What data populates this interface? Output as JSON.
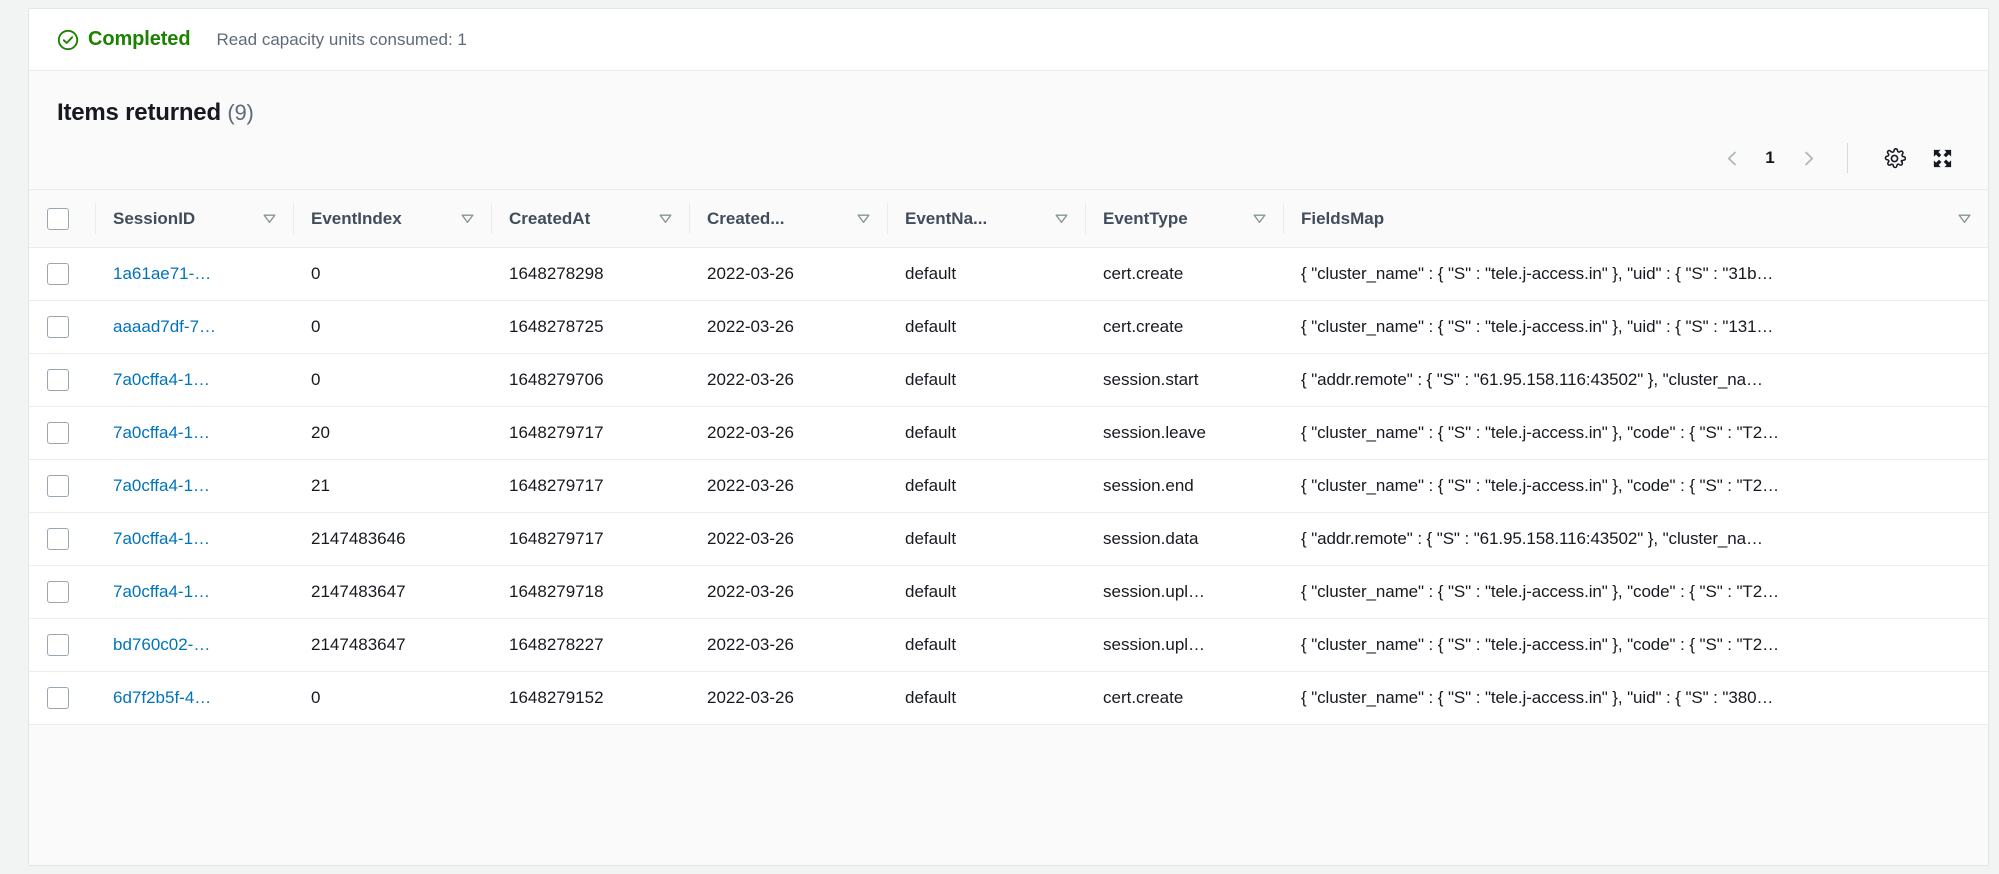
{
  "status": {
    "icon": "check-circle-icon",
    "label": "Completed",
    "meta": "Read capacity units consumed: 1",
    "color": "#1d8102"
  },
  "results": {
    "title": "Items returned",
    "count": "(9)"
  },
  "toolbar": {
    "prev_page_label": "‹",
    "page_number": "1",
    "next_page_label": "›",
    "settings_icon": "gear-icon",
    "fullscreen_icon": "expand-icon"
  },
  "table": {
    "columns": [
      {
        "key": "sessionid",
        "label": "SessionID",
        "sortable": true
      },
      {
        "key": "eventindex",
        "label": "EventIndex",
        "sortable": true
      },
      {
        "key": "createdat",
        "label": "CreatedAt",
        "sortable": true
      },
      {
        "key": "createddate",
        "label": "Created...",
        "sortable": true
      },
      {
        "key": "eventname",
        "label": "EventNa...",
        "sortable": true
      },
      {
        "key": "eventtype",
        "label": "EventType",
        "sortable": true
      },
      {
        "key": "fieldsmap",
        "label": "FieldsMap",
        "sortable": true
      }
    ],
    "rows": [
      {
        "sessionid": "1a61ae71-…",
        "eventindex": "0",
        "createdat": "1648278298",
        "createddate": "2022-03-26",
        "eventname": "default",
        "eventtype": "cert.create",
        "fieldsmap": "{ \"cluster_name\" : { \"S\" : \"tele.j-access.in\" }, \"uid\" : { \"S\" : \"31b…"
      },
      {
        "sessionid": "aaaad7df-7…",
        "eventindex": "0",
        "createdat": "1648278725",
        "createddate": "2022-03-26",
        "eventname": "default",
        "eventtype": "cert.create",
        "fieldsmap": "{ \"cluster_name\" : { \"S\" : \"tele.j-access.in\" }, \"uid\" : { \"S\" : \"131…"
      },
      {
        "sessionid": "7a0cffa4-1…",
        "eventindex": "0",
        "createdat": "1648279706",
        "createddate": "2022-03-26",
        "eventname": "default",
        "eventtype": "session.start",
        "fieldsmap": "{ \"addr.remote\" : { \"S\" : \"61.95.158.116:43502\" }, \"cluster_na…"
      },
      {
        "sessionid": "7a0cffa4-1…",
        "eventindex": "20",
        "createdat": "1648279717",
        "createddate": "2022-03-26",
        "eventname": "default",
        "eventtype": "session.leave",
        "fieldsmap": "{ \"cluster_name\" : { \"S\" : \"tele.j-access.in\" }, \"code\" : { \"S\" : \"T2…"
      },
      {
        "sessionid": "7a0cffa4-1…",
        "eventindex": "21",
        "createdat": "1648279717",
        "createddate": "2022-03-26",
        "eventname": "default",
        "eventtype": "session.end",
        "fieldsmap": "{ \"cluster_name\" : { \"S\" : \"tele.j-access.in\" }, \"code\" : { \"S\" : \"T2…"
      },
      {
        "sessionid": "7a0cffa4-1…",
        "eventindex": "2147483646",
        "createdat": "1648279717",
        "createddate": "2022-03-26",
        "eventname": "default",
        "eventtype": "session.data",
        "fieldsmap": "{ \"addr.remote\" : { \"S\" : \"61.95.158.116:43502\" }, \"cluster_na…"
      },
      {
        "sessionid": "7a0cffa4-1…",
        "eventindex": "2147483647",
        "createdat": "1648279718",
        "createddate": "2022-03-26",
        "eventname": "default",
        "eventtype": "session.upl…",
        "fieldsmap": "{ \"cluster_name\" : { \"S\" : \"tele.j-access.in\" }, \"code\" : { \"S\" : \"T2…"
      },
      {
        "sessionid": "bd760c02-…",
        "eventindex": "2147483647",
        "createdat": "1648278227",
        "createddate": "2022-03-26",
        "eventname": "default",
        "eventtype": "session.upl…",
        "fieldsmap": "{ \"cluster_name\" : { \"S\" : \"tele.j-access.in\" }, \"code\" : { \"S\" : \"T2…"
      },
      {
        "sessionid": "6d7f2b5f-4…",
        "eventindex": "0",
        "createdat": "1648279152",
        "createddate": "2022-03-26",
        "eventname": "default",
        "eventtype": "cert.create",
        "fieldsmap": "{ \"cluster_name\" : { \"S\" : \"tele.j-access.in\" }, \"uid\" : { \"S\" : \"380…"
      }
    ]
  },
  "colors": {
    "link": "#0073bb",
    "success": "#1d8102",
    "header_text": "#414d5c",
    "body_text": "#16191f",
    "muted": "#5f6b7a",
    "border": "#e9ebed",
    "section_bg": "#fafafa"
  }
}
